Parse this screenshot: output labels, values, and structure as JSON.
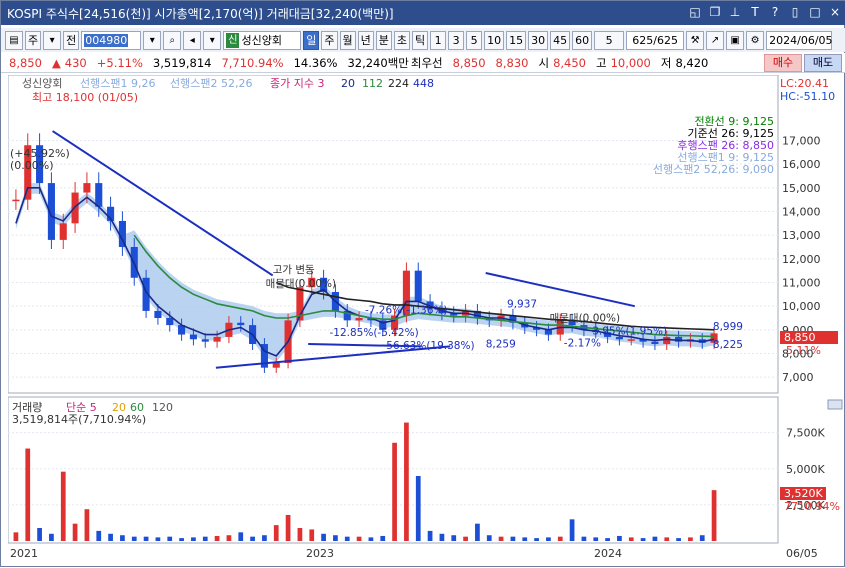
{
  "titlebar": {
    "title": "KOSPI 주식수[24,516(천)] 시가총액[2,170(억)] 거래대금[32,240(백만)]",
    "icons": [
      "layout-icon",
      "window-icon",
      "pin-icon",
      "font-size-icon",
      "help-icon",
      "restore-icon",
      "maximize-icon",
      "close-icon"
    ],
    "icon_glyphs": [
      "◱",
      "❐",
      "⊥",
      "T",
      "?",
      "▯",
      "□",
      "×"
    ]
  },
  "toolbar": {
    "market": "주",
    "market2": "전",
    "code": "004980",
    "name_badge": "신",
    "name": "성신양회",
    "periods": [
      "일",
      "주",
      "월",
      "년",
      "분",
      "초",
      "틱"
    ],
    "selected_period": "일",
    "minutes": [
      "1",
      "3",
      "5",
      "10",
      "15",
      "30",
      "45",
      "60"
    ],
    "interval_value": "5",
    "count": "625/625",
    "date": "2024/06/05"
  },
  "pricebar": {
    "price": "8,850",
    "arrow": "▲",
    "change": "430",
    "pct": "+5.11%",
    "volume": "3,519,814",
    "vol_pct": "7,710.94%",
    "turnover_pct": "14.36%",
    "amount": "32,240백만",
    "best_bid_label": "최우선",
    "best_bid": "8,850",
    "best_ask": "8,830",
    "open_label": "시",
    "open": "8,450",
    "high_label": "고",
    "high": "10,000",
    "low_label": "저",
    "low": "8,420",
    "buy": "매수",
    "sell": "매도"
  },
  "chart_data": {
    "type": "line",
    "legend_top": {
      "name": "성신양회",
      "items": [
        "선행스팬1 9,26",
        "선행스팬2 52,26",
        "종가 지수 3",
        "20",
        "112",
        "224",
        "448"
      ]
    },
    "max_note": "최고 18,100 (01/05)",
    "left_note": "(+45.92%)",
    "left_note2": "(0.00%)",
    "lc_label": "LC:20.41",
    "hc_label": "HC:-51.10",
    "ichimoku_legend": [
      {
        "label": "전환선 9: 9,125",
        "color": "#008000"
      },
      {
        "label": "기준선 26: 9,125",
        "color": "#000000"
      },
      {
        "label": "후행스팬 26: 8,850",
        "color": "#8a2be2"
      },
      {
        "label": "선행스팬1 9: 9,125",
        "color": "#87aadd"
      },
      {
        "label": "선행스팬2 52,26: 9,090",
        "color": "#87aadd"
      }
    ],
    "y_ticks": [
      "17,000",
      "16,000",
      "15,000",
      "14,000",
      "13,000",
      "12,000",
      "11,000",
      "10,000",
      "9,000",
      "8,000",
      "7,000"
    ],
    "ylim": [
      6500,
      18500
    ],
    "current_price_tag": "8,850",
    "current_pct_tag": "5.11%",
    "annotations": [
      "9,937",
      "8,259",
      "8,999",
      "8,225",
      "매물대(0.00%)",
      "매물대(0.00%)",
      "-12.85%(-5.42%)",
      "56.63%(19.38%)",
      "-2.17%",
      "3.95%(1.95%)",
      "-7.26%(-1.36%)",
      "고가 변동"
    ],
    "x_labels": [
      "2021",
      "2023",
      "2024",
      "06/05"
    ],
    "close_series": [
      14500,
      16800,
      15200,
      12800,
      13500,
      14800,
      15200,
      14200,
      13600,
      12500,
      11200,
      9800,
      9500,
      9200,
      8800,
      8600,
      8500,
      8700,
      9300,
      9200,
      8400,
      7400,
      7600,
      9400,
      10800,
      11200,
      10600,
      9800,
      9400,
      9500,
      9400,
      9000,
      9600,
      11500,
      10200,
      9900,
      9700,
      9600,
      9800,
      9500,
      9400,
      9600,
      9300,
      9100,
      9000,
      8800,
      9400,
      9200,
      9000,
      8900,
      8700,
      8600,
      8600,
      8500,
      8400,
      8700,
      8500,
      8600,
      8450,
      8850
    ],
    "ma20_series": [
      13500,
      15000,
      15000,
      13800,
      13600,
      14200,
      14600,
      14200,
      13700,
      12800,
      11800,
      10600,
      10000,
      9600,
      9200,
      9000,
      8800,
      8800,
      9000,
      9100,
      8800,
      8100,
      7900,
      8500,
      9600,
      10500,
      10700,
      10200,
      9800,
      9600,
      9500,
      9300,
      9400,
      10200,
      10200,
      10000,
      9800,
      9700,
      9700,
      9600,
      9500,
      9500,
      9400,
      9200,
      9100,
      9000,
      9100,
      9100,
      9000,
      8950,
      8850,
      8750,
      8700,
      8600,
      8550,
      8600,
      8550,
      8550,
      8500,
      8600
    ],
    "ma112_series": [
      null,
      null,
      null,
      null,
      null,
      null,
      null,
      null,
      null,
      null,
      13000,
      12300,
      11700,
      11200,
      10800,
      10500,
      10300,
      10100,
      10000,
      9900,
      9800,
      9600,
      9500,
      9500,
      9600,
      9700,
      9800,
      9800,
      9700,
      9600,
      9500,
      9450,
      9450,
      9600,
      9700,
      9650,
      9600,
      9550,
      9550,
      9500,
      9450,
      9400,
      9350,
      9300,
      9250,
      9200,
      9200,
      9150,
      9100,
      9050,
      9000,
      8950,
      8900,
      8850,
      8800,
      8780,
      8760,
      8750,
      8730,
      8720
    ],
    "ma224_series": [
      null,
      null,
      null,
      null,
      null,
      null,
      null,
      null,
      null,
      null,
      null,
      null,
      null,
      null,
      null,
      null,
      null,
      null,
      null,
      null,
      null,
      null,
      11000,
      10800,
      10700,
      10600,
      10500,
      10400,
      10300,
      10250,
      10200,
      10100,
      10050,
      10050,
      10000,
      9950,
      9900,
      9850,
      9800,
      9750,
      9700,
      9650,
      9600,
      9550,
      9500,
      9450,
      9420,
      9400,
      9350,
      9300,
      9250,
      9200,
      9150,
      9120,
      9100,
      9080,
      9060,
      9040,
      9020,
      9000
    ],
    "trend_lines": [
      {
        "from": [
          0.06,
          17400
        ],
        "to": [
          0.37,
          11300
        ]
      },
      {
        "from": [
          0.29,
          7400
        ],
        "to": [
          0.62,
          8300
        ]
      },
      {
        "from": [
          0.67,
          11400
        ],
        "to": [
          0.88,
          10000
        ]
      },
      {
        "from": [
          0.42,
          8400
        ],
        "to": [
          0.58,
          8300
        ]
      }
    ]
  },
  "volume_data": {
    "legend": {
      "name": "거래량",
      "ma_label": "단순 5",
      "ma20": "20",
      "ma60": "60",
      "ma120": "120"
    },
    "summary": "3,519,814주(7,710.94%)",
    "y_ticks": [
      "7,500K",
      "5,000K",
      "2,500K"
    ],
    "ylim": [
      0,
      9000
    ],
    "current_tag": "3,520K",
    "current_pct_tag": "7710.94%",
    "values": [
      600,
      6400,
      900,
      500,
      4800,
      1200,
      2200,
      700,
      500,
      400,
      300,
      300,
      250,
      300,
      200,
      250,
      300,
      350,
      400,
      600,
      300,
      400,
      1100,
      1800,
      900,
      800,
      500,
      400,
      300,
      300,
      250,
      350,
      6800,
      8200,
      4500,
      700,
      500,
      400,
      300,
      1200,
      400,
      300,
      300,
      250,
      200,
      250,
      300,
      1500,
      300,
      250,
      200,
      350,
      250,
      200,
      300,
      250,
      200,
      250,
      400,
      3520
    ]
  },
  "colors": {
    "title_bg": "#2d4d8c",
    "up": "#e03131",
    "down": "#1c4fd6",
    "ichimoku_cloud": "#a9c8ee",
    "trend": "#1c2fbf",
    "ma20": "#1a2a8a",
    "ma112": "#2b8a3e",
    "ma224": "#222222"
  }
}
